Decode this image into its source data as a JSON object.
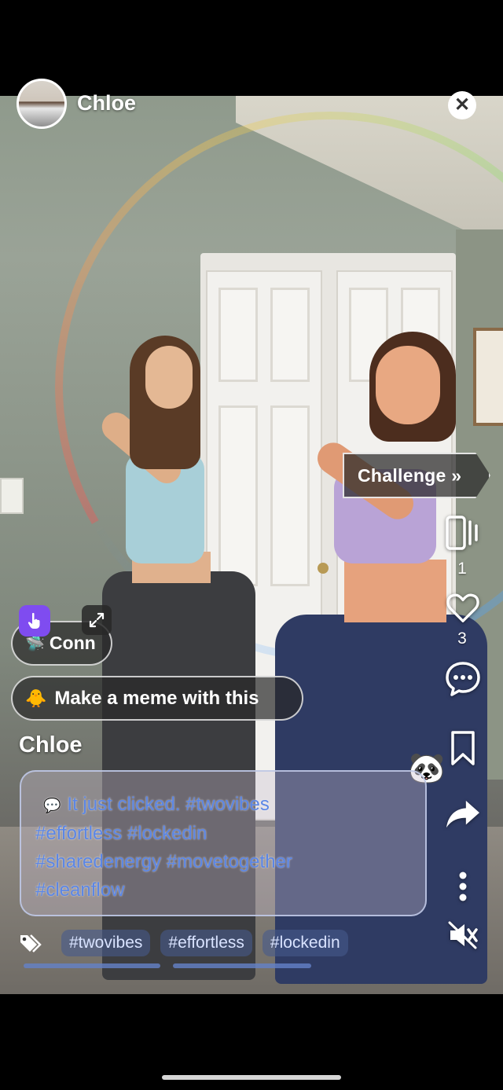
{
  "header": {
    "username": "Chloe",
    "close_symbol": "✕"
  },
  "challenge": {
    "label": "Challenge »"
  },
  "side_actions": {
    "clips_count": "1",
    "likes_count": "3"
  },
  "pills": {
    "connect_label": "Conn",
    "connect_emoji": "🛸",
    "meme_label": "Make a meme with this",
    "meme_emoji": "🐥"
  },
  "post": {
    "author": "Chloe",
    "caption_emoji": "💬",
    "caption_lines": [
      "It just clicked.  #twovibes",
      "#effortless #lockedin",
      "#sharedenergy #movetogether",
      "#cleanflow"
    ],
    "hashtags": [
      "#twovibes",
      "#effortless",
      "#lockedin"
    ]
  },
  "misc": {
    "panda_emoji": "🐼"
  },
  "colors": {
    "accent_purple": "#7f4cf0",
    "caption_blue": "#5b86e5"
  }
}
